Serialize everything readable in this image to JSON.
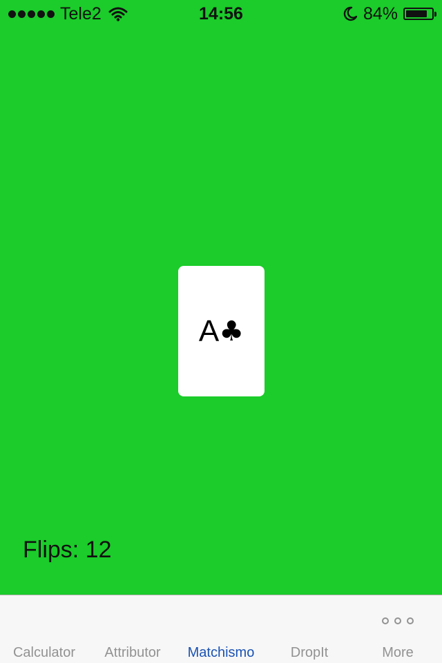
{
  "status_bar": {
    "carrier": "Tele2",
    "time": "14:56",
    "battery_percent": "84%",
    "battery_level": 0.84,
    "signal_bars": 5,
    "icons": [
      "signal-dots-icon",
      "wifi-icon",
      "moon-icon",
      "battery-icon"
    ]
  },
  "card": {
    "rank": "A",
    "suit": "♣",
    "background_color": "#ffffff"
  },
  "game": {
    "flips_text": "Flips: 12",
    "background_color": "#1bcc2a"
  },
  "tab_bar": {
    "tabs": [
      {
        "label": "Calculator",
        "active": false
      },
      {
        "label": "Attributor",
        "active": false
      },
      {
        "label": "Matchismo",
        "active": true
      },
      {
        "label": "DropIt",
        "active": false
      },
      {
        "label": "More",
        "active": false,
        "icon": "more-ellipsis-icon"
      }
    ],
    "active_color": "#1a52b3",
    "inactive_color": "#929292"
  }
}
